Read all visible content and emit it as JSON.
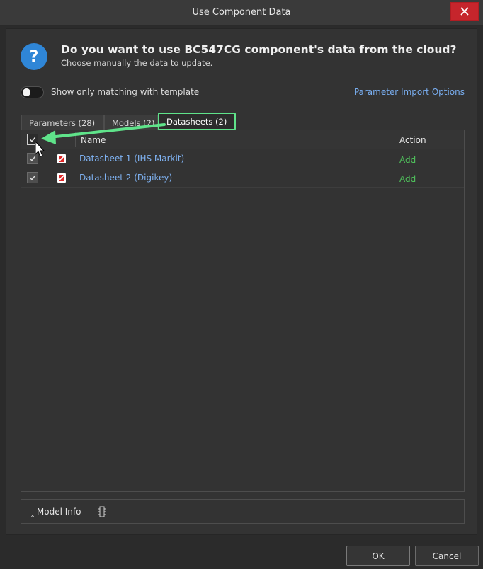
{
  "window": {
    "title": "Use Component Data",
    "close_icon": "close-icon"
  },
  "header": {
    "question": "Do you want to use BC547CG component's data from the cloud?",
    "subtitle": "Choose manually the data to update.",
    "icon": "question-icon",
    "icon_color": "#2f86d7"
  },
  "options": {
    "toggle_label": "Show only matching with template",
    "toggle_on": false,
    "import_options_link": "Parameter Import Options"
  },
  "tabs": [
    {
      "label": "Parameters (28)",
      "active": false
    },
    {
      "label": "Models (2)",
      "active": false
    },
    {
      "label": "Datasheets (2)",
      "active": true
    }
  ],
  "table": {
    "columns": [
      "Name",
      "Action"
    ],
    "header_checked": true,
    "rows": [
      {
        "checked": true,
        "icon": "pdf-icon",
        "name": "Datasheet 1 (IHS Markit)",
        "action": "Add"
      },
      {
        "checked": true,
        "icon": "pdf-icon",
        "name": "Datasheet 2 (Digikey)",
        "action": "Add"
      }
    ]
  },
  "model_info": {
    "label": "Model Info",
    "icon": "chip-icon"
  },
  "footer": {
    "ok_label": "OK",
    "cancel_label": "Cancel"
  },
  "colors": {
    "highlight": "#5fe38a",
    "link": "#7fb2f2",
    "action": "#4fc15b",
    "close": "#c6252c"
  }
}
